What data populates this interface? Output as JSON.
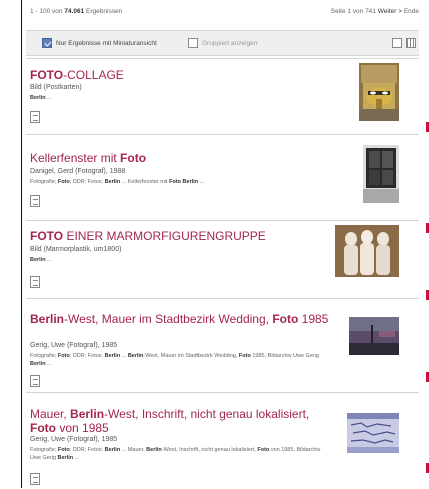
{
  "results_bar": {
    "range": "1 - 100 von",
    "count": "74.061",
    "count_suffix": "Ergebnissen",
    "page_info": "Seite 1 von 741",
    "next_label": "Weiter >",
    "end_label": "Ende"
  },
  "filters": {
    "thumbnails_only": "Nur Ergebnisse mit Miniaturansicht",
    "grouped": "Gruppiert anzeigen"
  },
  "results": [
    {
      "title_parts": [
        {
          "t": "FOTO",
          "hl": true
        },
        {
          "t": "-COLLAGE",
          "hl": false
        }
      ],
      "subtitle": "Bild (Postkarten)",
      "snippet_parts": [
        {
          "t": "Berlin",
          "b": true
        },
        {
          "t": " ...",
          "b": false
        }
      ]
    },
    {
      "title_parts": [
        {
          "t": "Kellerfenster mit ",
          "hl": false
        },
        {
          "t": "Foto",
          "hl": true
        }
      ],
      "subtitle": "Danigel, Gerd (Fotograf), 1988",
      "snippet_parts": [
        {
          "t": "Fotografie; ",
          "b": false
        },
        {
          "t": "Foto",
          "b": true
        },
        {
          "t": "; DDR; Fotos; ",
          "b": false
        },
        {
          "t": "Berlin",
          "b": true
        },
        {
          "t": " ... Kellerfenster mit ",
          "b": false
        },
        {
          "t": "Foto Berlin",
          "b": true
        },
        {
          "t": " ...",
          "b": false
        }
      ]
    },
    {
      "title_parts": [
        {
          "t": "FOTO",
          "hl": true
        },
        {
          "t": " EINER MARMORFIGURENGRUPPE",
          "hl": false
        }
      ],
      "subtitle": "Bild (Marmorplastik, um1800)",
      "snippet_parts": [
        {
          "t": "Berlin",
          "b": true
        },
        {
          "t": " ...",
          "b": false
        }
      ]
    },
    {
      "title_parts": [
        {
          "t": "Berlin",
          "hl": true
        },
        {
          "t": "-West, Mauer im Stadtbezirk Wedding, ",
          "hl": false
        },
        {
          "t": "Foto",
          "hl": true
        },
        {
          "t": " 1985",
          "hl": false
        }
      ],
      "subtitle": "Gerig, Uwe (Fotograf), 1985",
      "snippet_parts": [
        {
          "t": "Fotografie; ",
          "b": false
        },
        {
          "t": "Foto",
          "b": true
        },
        {
          "t": "; DDR; Fotos; ",
          "b": false
        },
        {
          "t": "Berlin",
          "b": true
        },
        {
          "t": " ... ",
          "b": false
        },
        {
          "t": "Berlin",
          "b": true
        },
        {
          "t": "-West, Mauer im Stadtbezirk Wedding, ",
          "b": false
        },
        {
          "t": "Foto",
          "b": true
        },
        {
          "t": " 1985, Bildarchiv Uwe Gerig ",
          "b": false
        },
        {
          "t": "Berlin",
          "b": true
        },
        {
          "t": " ...",
          "b": false
        }
      ]
    },
    {
      "title_parts": [
        {
          "t": "Mauer, ",
          "hl": false
        },
        {
          "t": "Berlin",
          "hl": true
        },
        {
          "t": "-West, Inschrift, nicht genau lokalisiert, ",
          "hl": false
        },
        {
          "t": "Foto",
          "hl": true
        },
        {
          "t": " von 1985",
          "hl": false
        }
      ],
      "subtitle": "Gerig, Uwe (Fotograf), 1985",
      "snippet_parts": [
        {
          "t": "Fotografie; ",
          "b": false
        },
        {
          "t": "Foto",
          "b": true
        },
        {
          "t": "; DDR; Fotos; ",
          "b": false
        },
        {
          "t": "Berlin",
          "b": true
        },
        {
          "t": " ... Mauer, ",
          "b": false
        },
        {
          "t": "Berlin",
          "b": true
        },
        {
          "t": "-West, Inschrift, nicht genau lokalisiert, ",
          "b": false
        },
        {
          "t": "Foto",
          "b": true
        },
        {
          "t": " von 1985, Bildarchiv Uwe Gerig ",
          "b": false
        },
        {
          "t": "Berlin",
          "b": true
        },
        {
          "t": " ...",
          "b": false
        }
      ]
    }
  ],
  "colors": {
    "accent": "#a3264b",
    "checkbox": "#5d7fb6"
  }
}
